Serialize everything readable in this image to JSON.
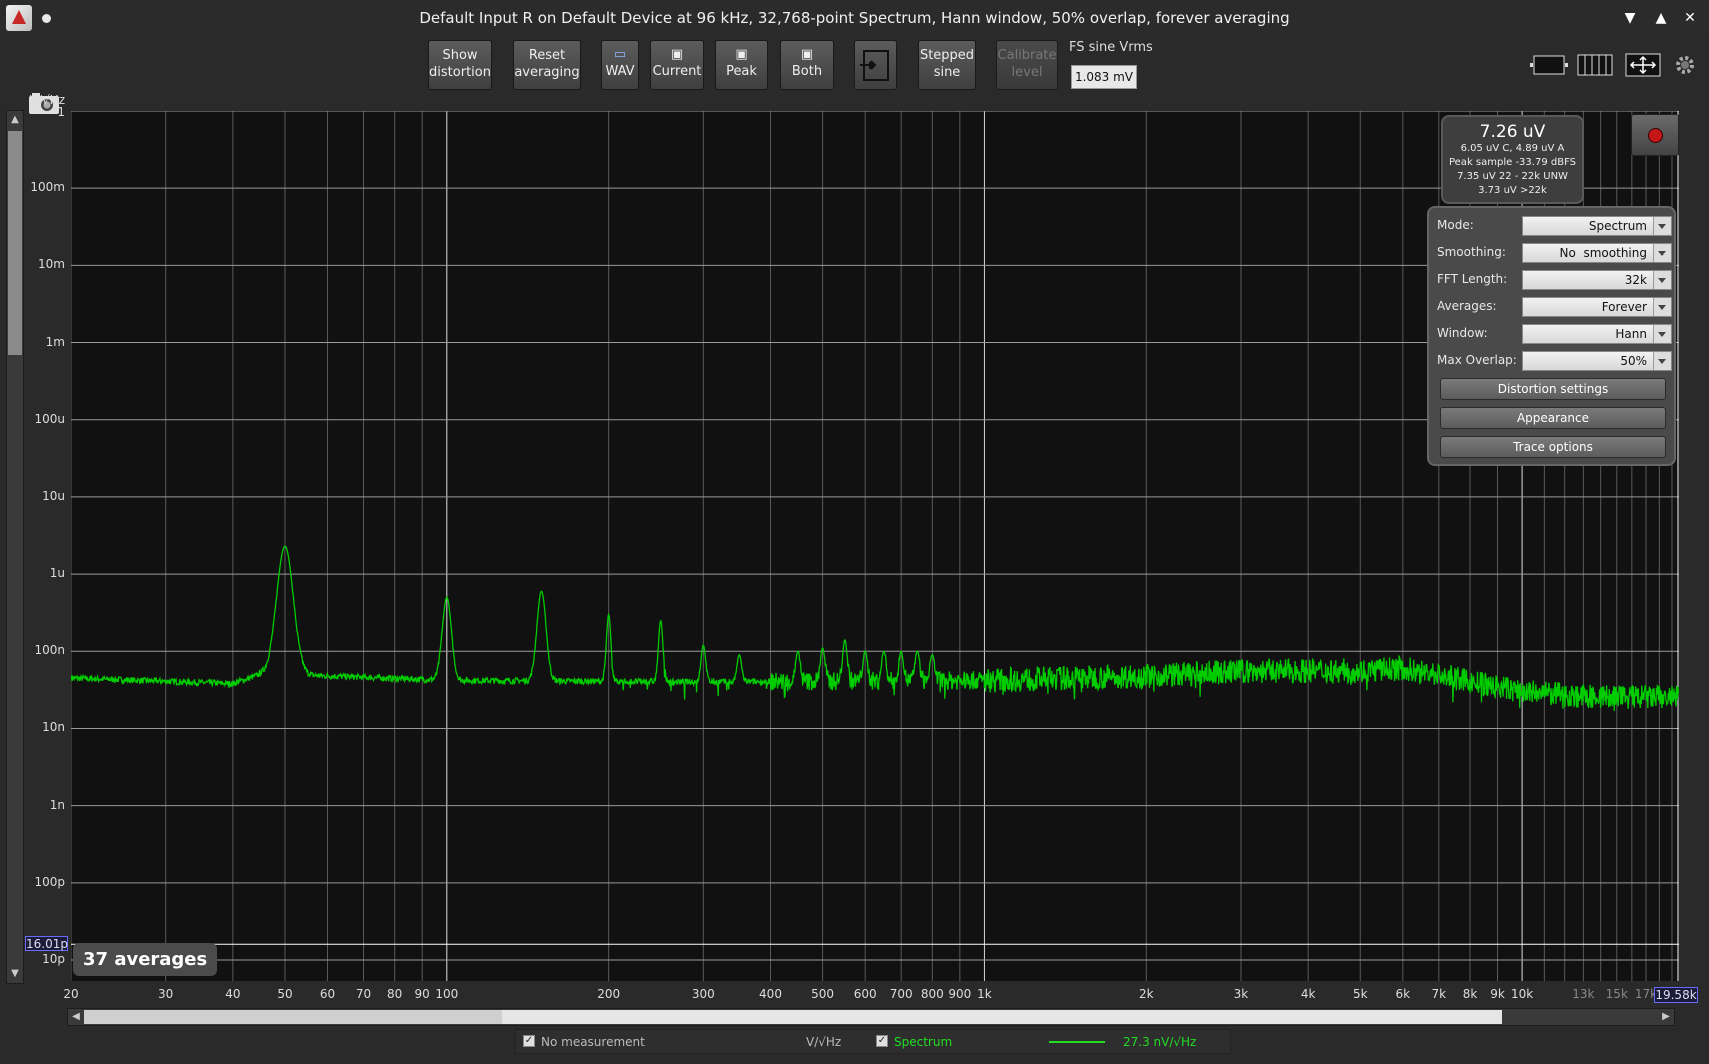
{
  "title": {
    "window_title": "Default Input R on Default Device at 96 kHz, 32,768-point Spectrum, Hann window, 50% overlap, forever averaging",
    "minimize": "▼",
    "maximize": "▲",
    "close": "✕"
  },
  "toolbar": {
    "show_distortion": "Show distortion",
    "reset_averaging": "Reset averaging",
    "wav": "WAV",
    "current": "Current",
    "peak": "Peak",
    "both": "Both",
    "stepped_sine": "Stepped sine",
    "calibrate_level": "Calibrate level",
    "fs_label": "FS sine Vrms",
    "fs_value": "1.083 mV"
  },
  "readout": {
    "main": "7.26 uV",
    "line1": "6.05 uV C, 4.89 uV A",
    "line2": "Peak sample -33.79 dBFS",
    "line3": "7.35 uV 22 - 22k UNW",
    "line4": "3.73 uV >22k"
  },
  "panel": {
    "mode_label": "Mode:",
    "mode_value": "Spectrum",
    "smoothing_label": "Smoothing:",
    "smoothing_value": "No  smoothing",
    "fft_label": "FFT Length:",
    "fft_value": "32k",
    "averages_label": "Averages:",
    "averages_value": "Forever",
    "window_label": "Window:",
    "window_value": "Hann",
    "overlap_label": "Max Overlap:",
    "overlap_value": "50%",
    "distortion_settings": "Distortion settings",
    "appearance": "Appearance",
    "trace_options": "Trace options"
  },
  "averages_badge": "37 averages",
  "y_cursor": "16.01p",
  "x_cursor": "19.58k",
  "legend": {
    "no_measurement": "No measurement",
    "unit": "V/√Hz",
    "spectrum": "Spectrum",
    "value": "27.3 nV/√Hz"
  },
  "colors": {
    "trace": "#00cc00",
    "plot_bg": "#111111",
    "grid_major": "#d0d0d0",
    "grid_minor": "#5a5a5a"
  },
  "chart_data": {
    "type": "line",
    "ylabel": "V/√Hz",
    "xscale": "log",
    "yscale": "log",
    "xlim": [
      20,
      19580
    ],
    "ylim": [
      1e-11,
      1
    ],
    "x_tick_labels": [
      "20",
      "30",
      "40",
      "50",
      "60",
      "70",
      "80",
      "90",
      "100",
      "200",
      "300",
      "400",
      "500",
      "600",
      "700",
      "800",
      "900",
      "1k",
      "2k",
      "3k",
      "4k",
      "5k",
      "6k",
      "7k",
      "8k",
      "9k",
      "10k",
      "13k",
      "15k",
      "17k"
    ],
    "x_tick_values": [
      20,
      30,
      40,
      50,
      60,
      70,
      80,
      90,
      100,
      200,
      300,
      400,
      500,
      600,
      700,
      800,
      900,
      1000,
      2000,
      3000,
      4000,
      5000,
      6000,
      7000,
      8000,
      9000,
      10000,
      13000,
      15000,
      17000
    ],
    "x_tick_dim": [
      "13k",
      "15k",
      "17k"
    ],
    "y_tick_labels": [
      "1",
      "100m",
      "10m",
      "1m",
      "100u",
      "10u",
      "1u",
      "100n",
      "10n",
      "1n",
      "100p",
      "10p"
    ],
    "y_tick_values": [
      1,
      0.1,
      0.01,
      0.001,
      0.0001,
      1e-05,
      1e-06,
      1e-07,
      1e-08,
      1e-09,
      1e-10,
      1e-11
    ],
    "series": [
      {
        "color": "#00cc00",
        "noise_floor": [
          [
            20,
            4.5e-08
          ],
          [
            40,
            3.8e-08
          ],
          [
            45,
            5e-08
          ],
          [
            60,
            4.8e-08
          ],
          [
            100,
            4.2e-08
          ],
          [
            300,
            4e-08
          ],
          [
            1000,
            4.2e-08
          ],
          [
            2000,
            4.8e-08
          ],
          [
            3000,
            5.5e-08
          ],
          [
            4000,
            5.6e-08
          ],
          [
            5000,
            5.6e-08
          ],
          [
            6000,
            6e-08
          ],
          [
            7000,
            5e-08
          ],
          [
            8000,
            4e-08
          ],
          [
            10000,
            3e-08
          ],
          [
            13000,
            2.6e-08
          ],
          [
            19580,
            2.5e-08
          ]
        ],
        "peaks": [
          [
            50,
            2.3e-06
          ],
          [
            100,
            5e-07
          ],
          [
            150,
            6e-07
          ],
          [
            200,
            3e-07
          ],
          [
            250,
            2.5e-07
          ],
          [
            300,
            1.2e-07
          ],
          [
            350,
            9e-08
          ],
          [
            450,
            1e-07
          ],
          [
            500,
            1.1e-07
          ],
          [
            550,
            1.4e-07
          ],
          [
            600,
            1e-07
          ],
          [
            650,
            1e-07
          ],
          [
            700,
            1e-07
          ],
          [
            750,
            1e-07
          ],
          [
            800,
            9e-08
          ]
        ]
      }
    ],
    "grid": true
  }
}
